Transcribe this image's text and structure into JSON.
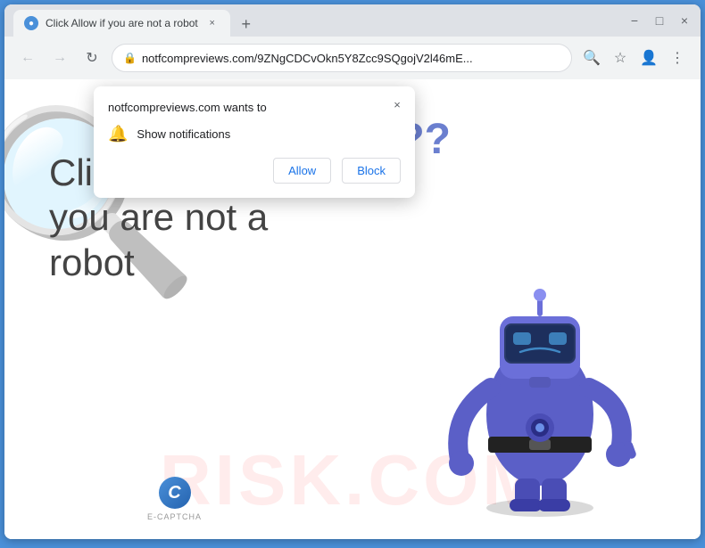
{
  "browser": {
    "tab": {
      "title": "Click Allow if you are not a robot",
      "favicon": "●",
      "close_label": "×"
    },
    "new_tab_label": "+",
    "window_controls": {
      "minimize": "−",
      "maximize": "□",
      "close": "×"
    },
    "nav": {
      "back_label": "←",
      "forward_label": "→",
      "reload_label": "↻",
      "lock_icon": "🔒",
      "url": "notfcompreviews.com/9ZNgCDCvOkn5Y8Zcc9SQgojV2l46mE...",
      "search_icon": "🔍",
      "bookmark_icon": "☆",
      "account_icon": "👤",
      "menu_icon": "⋮"
    }
  },
  "popup": {
    "site_text": "notfcompreviews.com wants to",
    "notification_text": "Show notifications",
    "allow_label": "Allow",
    "block_label": "Block",
    "close_label": "×"
  },
  "page": {
    "main_text": "Click Allow if you are not a robot",
    "question_marks": "??",
    "watermark": "RISK.COM",
    "ecaptcha_label": "C",
    "ecaptcha_text": "E-CAPTCHA"
  }
}
